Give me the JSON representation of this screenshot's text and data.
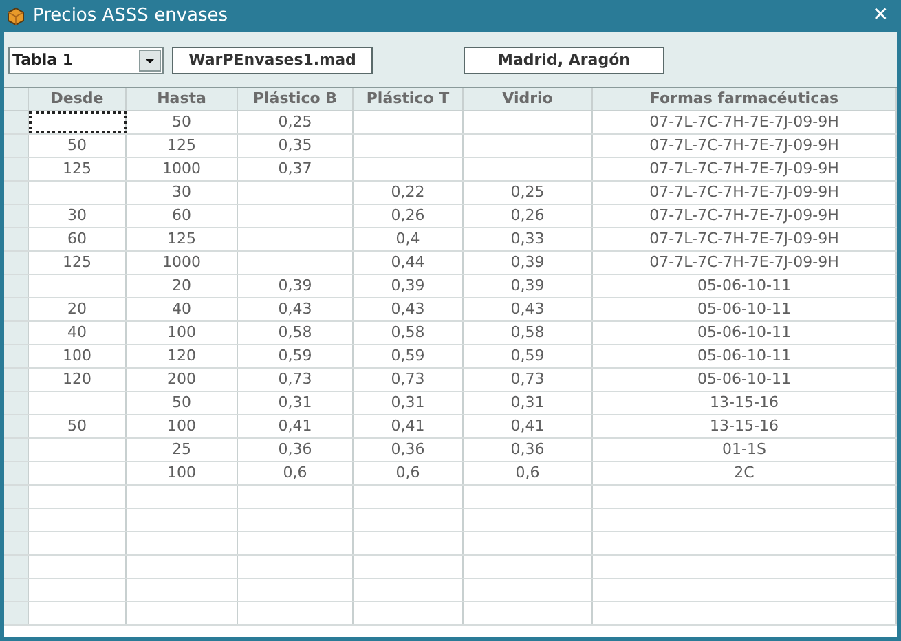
{
  "window": {
    "title": "Precios ASSS envases",
    "close": "✕"
  },
  "toolbar": {
    "table_select": "Tabla 1",
    "file": "WarPEnvases1.mad",
    "regions": "Madrid, Aragón"
  },
  "table": {
    "columns": [
      "Desde",
      "Hasta",
      "Plástico B",
      "Plástico T",
      "Vidrio",
      "Formas farmacéuticas"
    ],
    "rows": [
      {
        "focused": true,
        "cells": [
          "",
          "50",
          "0,25",
          "",
          "",
          "07-7L-7C-7H-7E-7J-09-9H"
        ]
      },
      {
        "focused": false,
        "cells": [
          "50",
          "125",
          "0,35",
          "",
          "",
          "07-7L-7C-7H-7E-7J-09-9H"
        ]
      },
      {
        "focused": false,
        "cells": [
          "125",
          "1000",
          "0,37",
          "",
          "",
          "07-7L-7C-7H-7E-7J-09-9H"
        ]
      },
      {
        "focused": false,
        "cells": [
          "",
          "30",
          "",
          "0,22",
          "0,25",
          "07-7L-7C-7H-7E-7J-09-9H"
        ]
      },
      {
        "focused": false,
        "cells": [
          "30",
          "60",
          "",
          "0,26",
          "0,26",
          "07-7L-7C-7H-7E-7J-09-9H"
        ]
      },
      {
        "focused": false,
        "cells": [
          "60",
          "125",
          "",
          "0,4",
          "0,33",
          "07-7L-7C-7H-7E-7J-09-9H"
        ]
      },
      {
        "focused": false,
        "cells": [
          "125",
          "1000",
          "",
          "0,44",
          "0,39",
          "07-7L-7C-7H-7E-7J-09-9H"
        ]
      },
      {
        "focused": false,
        "cells": [
          "",
          "20",
          "0,39",
          "0,39",
          "0,39",
          "05-06-10-11"
        ]
      },
      {
        "focused": false,
        "cells": [
          "20",
          "40",
          "0,43",
          "0,43",
          "0,43",
          "05-06-10-11"
        ]
      },
      {
        "focused": false,
        "cells": [
          "40",
          "100",
          "0,58",
          "0,58",
          "0,58",
          "05-06-10-11"
        ]
      },
      {
        "focused": false,
        "cells": [
          "100",
          "120",
          "0,59",
          "0,59",
          "0,59",
          "05-06-10-11"
        ]
      },
      {
        "focused": false,
        "cells": [
          "120",
          "200",
          "0,73",
          "0,73",
          "0,73",
          "05-06-10-11"
        ]
      },
      {
        "focused": false,
        "cells": [
          "",
          "50",
          "0,31",
          "0,31",
          "0,31",
          "13-15-16"
        ]
      },
      {
        "focused": false,
        "cells": [
          "50",
          "100",
          "0,41",
          "0,41",
          "0,41",
          "13-15-16"
        ]
      },
      {
        "focused": false,
        "cells": [
          "",
          "25",
          "0,36",
          "0,36",
          "0,36",
          "01-1S"
        ]
      },
      {
        "focused": false,
        "cells": [
          "",
          "100",
          "0,6",
          "0,6",
          "0,6",
          "2C"
        ]
      }
    ]
  }
}
